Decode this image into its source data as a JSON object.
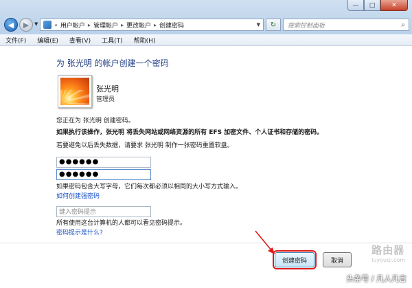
{
  "window": {
    "minimize": "—",
    "maximize": "□",
    "close": "✕"
  },
  "address": {
    "sep_start": "«",
    "crumbs": [
      "用户帐户",
      "管理帐户",
      "更改帐户",
      "创建密码"
    ],
    "sep": "▸"
  },
  "search": {
    "placeholder": "搜索控制面板"
  },
  "menu": [
    "文件(F)",
    "编辑(E)",
    "查看(V)",
    "工具(T)",
    "帮助(H)"
  ],
  "content": {
    "heading": "为 张光明 的帐户创建一个密码",
    "user_name": "张光明",
    "user_role": "管理员",
    "line1": "您正在为 张光明 创建密码。",
    "line2": "如果执行该操作，张光明 将丢失网站或网络资源的所有 EFS 加密文件、个人证书和存储的密码。",
    "line3": "若要避免以后丢失数据，请要求 张光明 制作一张密码重置软盘。",
    "password1": "●●●●●●",
    "password2": "●●●●●●",
    "case_note": "如果密码包含大写字母，它们每次都必须以相同的大小写方式输入。",
    "link_strong": "如何创建强密码",
    "hint_placeholder": "键入密码提示",
    "hint_note": "所有使用这台计算机的人都可以看见密码提示。",
    "link_hint": "密码提示是什么?"
  },
  "buttons": {
    "create": "创建密码",
    "cancel": "取消"
  },
  "watermark": {
    "main": "路由器",
    "sub": "luyouqi.com"
  },
  "credit": "头条号 / 凡人凡言",
  "colors": {
    "accent": "#1e3d84",
    "link": "#1550c8",
    "highlight": "#e21a1a"
  }
}
